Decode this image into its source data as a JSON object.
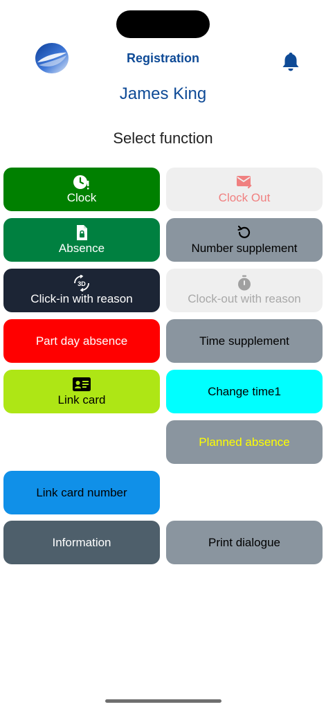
{
  "header": {
    "title": "Registration",
    "logo_icon": "logo-swirl-icon",
    "notification_icon": "bell-icon"
  },
  "user": {
    "name": "James King"
  },
  "main": {
    "heading": "Select function",
    "buttons": [
      {
        "label": "Clock",
        "icon": "clock-alert-icon",
        "bg": "#008000",
        "fg": "#ffffff"
      },
      {
        "label": "Clock Out",
        "icon": "mail-forward-icon",
        "bg": "#efefef",
        "fg": "#f08080"
      },
      {
        "label": "Absence",
        "icon": "file-lock-icon",
        "bg": "#008040",
        "fg": "#ffffff"
      },
      {
        "label": "Number supplement",
        "icon": "refresh-icon",
        "bg": "#8a959f",
        "fg": "#000000"
      },
      {
        "label": "Click-in with reason",
        "icon": "rotate-3d-icon",
        "bg": "#1c2535",
        "fg": "#ffffff"
      },
      {
        "label": "Clock-out with reason",
        "icon": "stopwatch-icon",
        "bg": "#efefef",
        "fg": "#a8a8a8"
      },
      {
        "label": "Part day absence",
        "bg": "#ff0000",
        "fg": "#ffffff"
      },
      {
        "label": "Time supplement",
        "bg": "#8a959f",
        "fg": "#000000"
      },
      {
        "label": "Link card",
        "icon": "id-card-icon",
        "bg": "#aee615",
        "fg": "#000000"
      },
      {
        "label": "Change time1",
        "bg": "#00ffff",
        "fg": "#000000"
      },
      {
        "label": "Planned absence",
        "bg": "#8a959f",
        "fg": "#ffff00"
      },
      {
        "label": "Link card number",
        "bg": "#1090e8",
        "fg": "#000000"
      },
      {
        "label": "Information",
        "bg": "#4e5f6b",
        "fg": "#ffffff"
      },
      {
        "label": "Print dialogue",
        "bg": "#8a959f",
        "fg": "#000000"
      }
    ]
  },
  "colors": {
    "brand": "#0e4a96",
    "heading_text": "#222222"
  }
}
